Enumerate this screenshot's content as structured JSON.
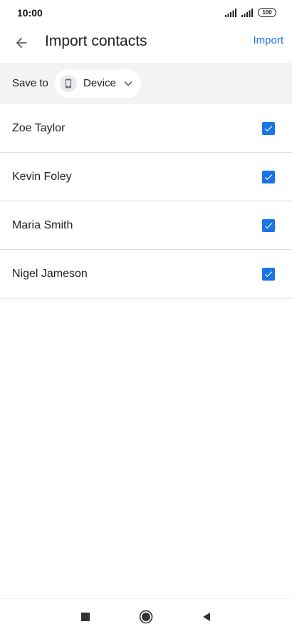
{
  "status_bar": {
    "time": "10:00",
    "battery": "100"
  },
  "app_bar": {
    "title": "Import contacts",
    "action_label": "Import"
  },
  "save_to": {
    "label": "Save to",
    "selected": "Device"
  },
  "contacts": [
    {
      "name": "Zoe Taylor",
      "checked": true
    },
    {
      "name": "Kevin Foley",
      "checked": true
    },
    {
      "name": "Maria Smith",
      "checked": true
    },
    {
      "name": "Nigel Jameson",
      "checked": true
    }
  ],
  "colors": {
    "accent": "#1a73e8",
    "save_bar_bg": "#f1f3f4",
    "divider": "#dadce0",
    "text": "#202124"
  },
  "icons": {
    "back": "arrow-left-icon",
    "device": "phone-icon",
    "dropdown": "chevron-down-icon",
    "check": "check-icon",
    "nav_recents": "square-icon",
    "nav_home": "circle-icon",
    "nav_back": "triangle-left-icon"
  }
}
